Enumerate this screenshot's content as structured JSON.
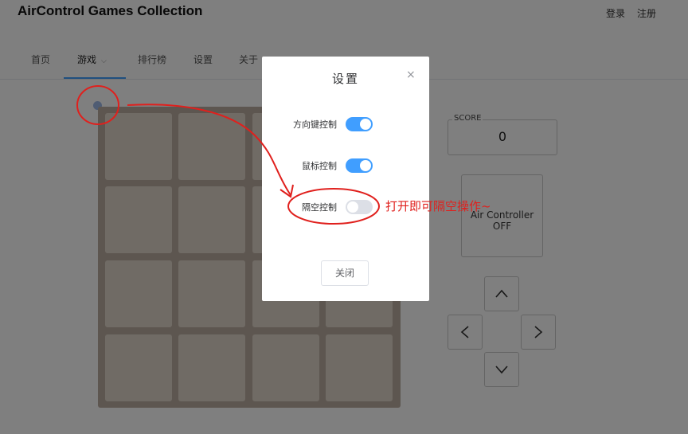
{
  "header": {
    "app_title": "AirControl Games Collection",
    "login": "登录",
    "register": "注册"
  },
  "nav": {
    "items": [
      {
        "label": "首页"
      },
      {
        "label": "游戏"
      },
      {
        "label": "排行榜"
      },
      {
        "label": "设置"
      },
      {
        "label": "关于"
      }
    ]
  },
  "score": {
    "label": "SCORE",
    "value": "0"
  },
  "air_controller": {
    "line1": "Air Controller",
    "line2": "OFF"
  },
  "dialog": {
    "title": "设置",
    "close_icon": "×",
    "settings": [
      {
        "label": "方向键控制",
        "on": true
      },
      {
        "label": "鼠标控制",
        "on": true
      },
      {
        "label": "隔空控制",
        "on": false
      }
    ],
    "close_button": "关闭"
  },
  "annotation": {
    "text": "打开即可隔空操作~",
    "color": "#e0201d"
  },
  "colors": {
    "accent": "#409eff",
    "board": "#bbada0",
    "tile": "#eee4da"
  },
  "icons": [
    "chevron-down-icon",
    "arrow-up-icon",
    "arrow-left-icon",
    "arrow-right-icon",
    "arrow-down-icon",
    "close-icon"
  ]
}
